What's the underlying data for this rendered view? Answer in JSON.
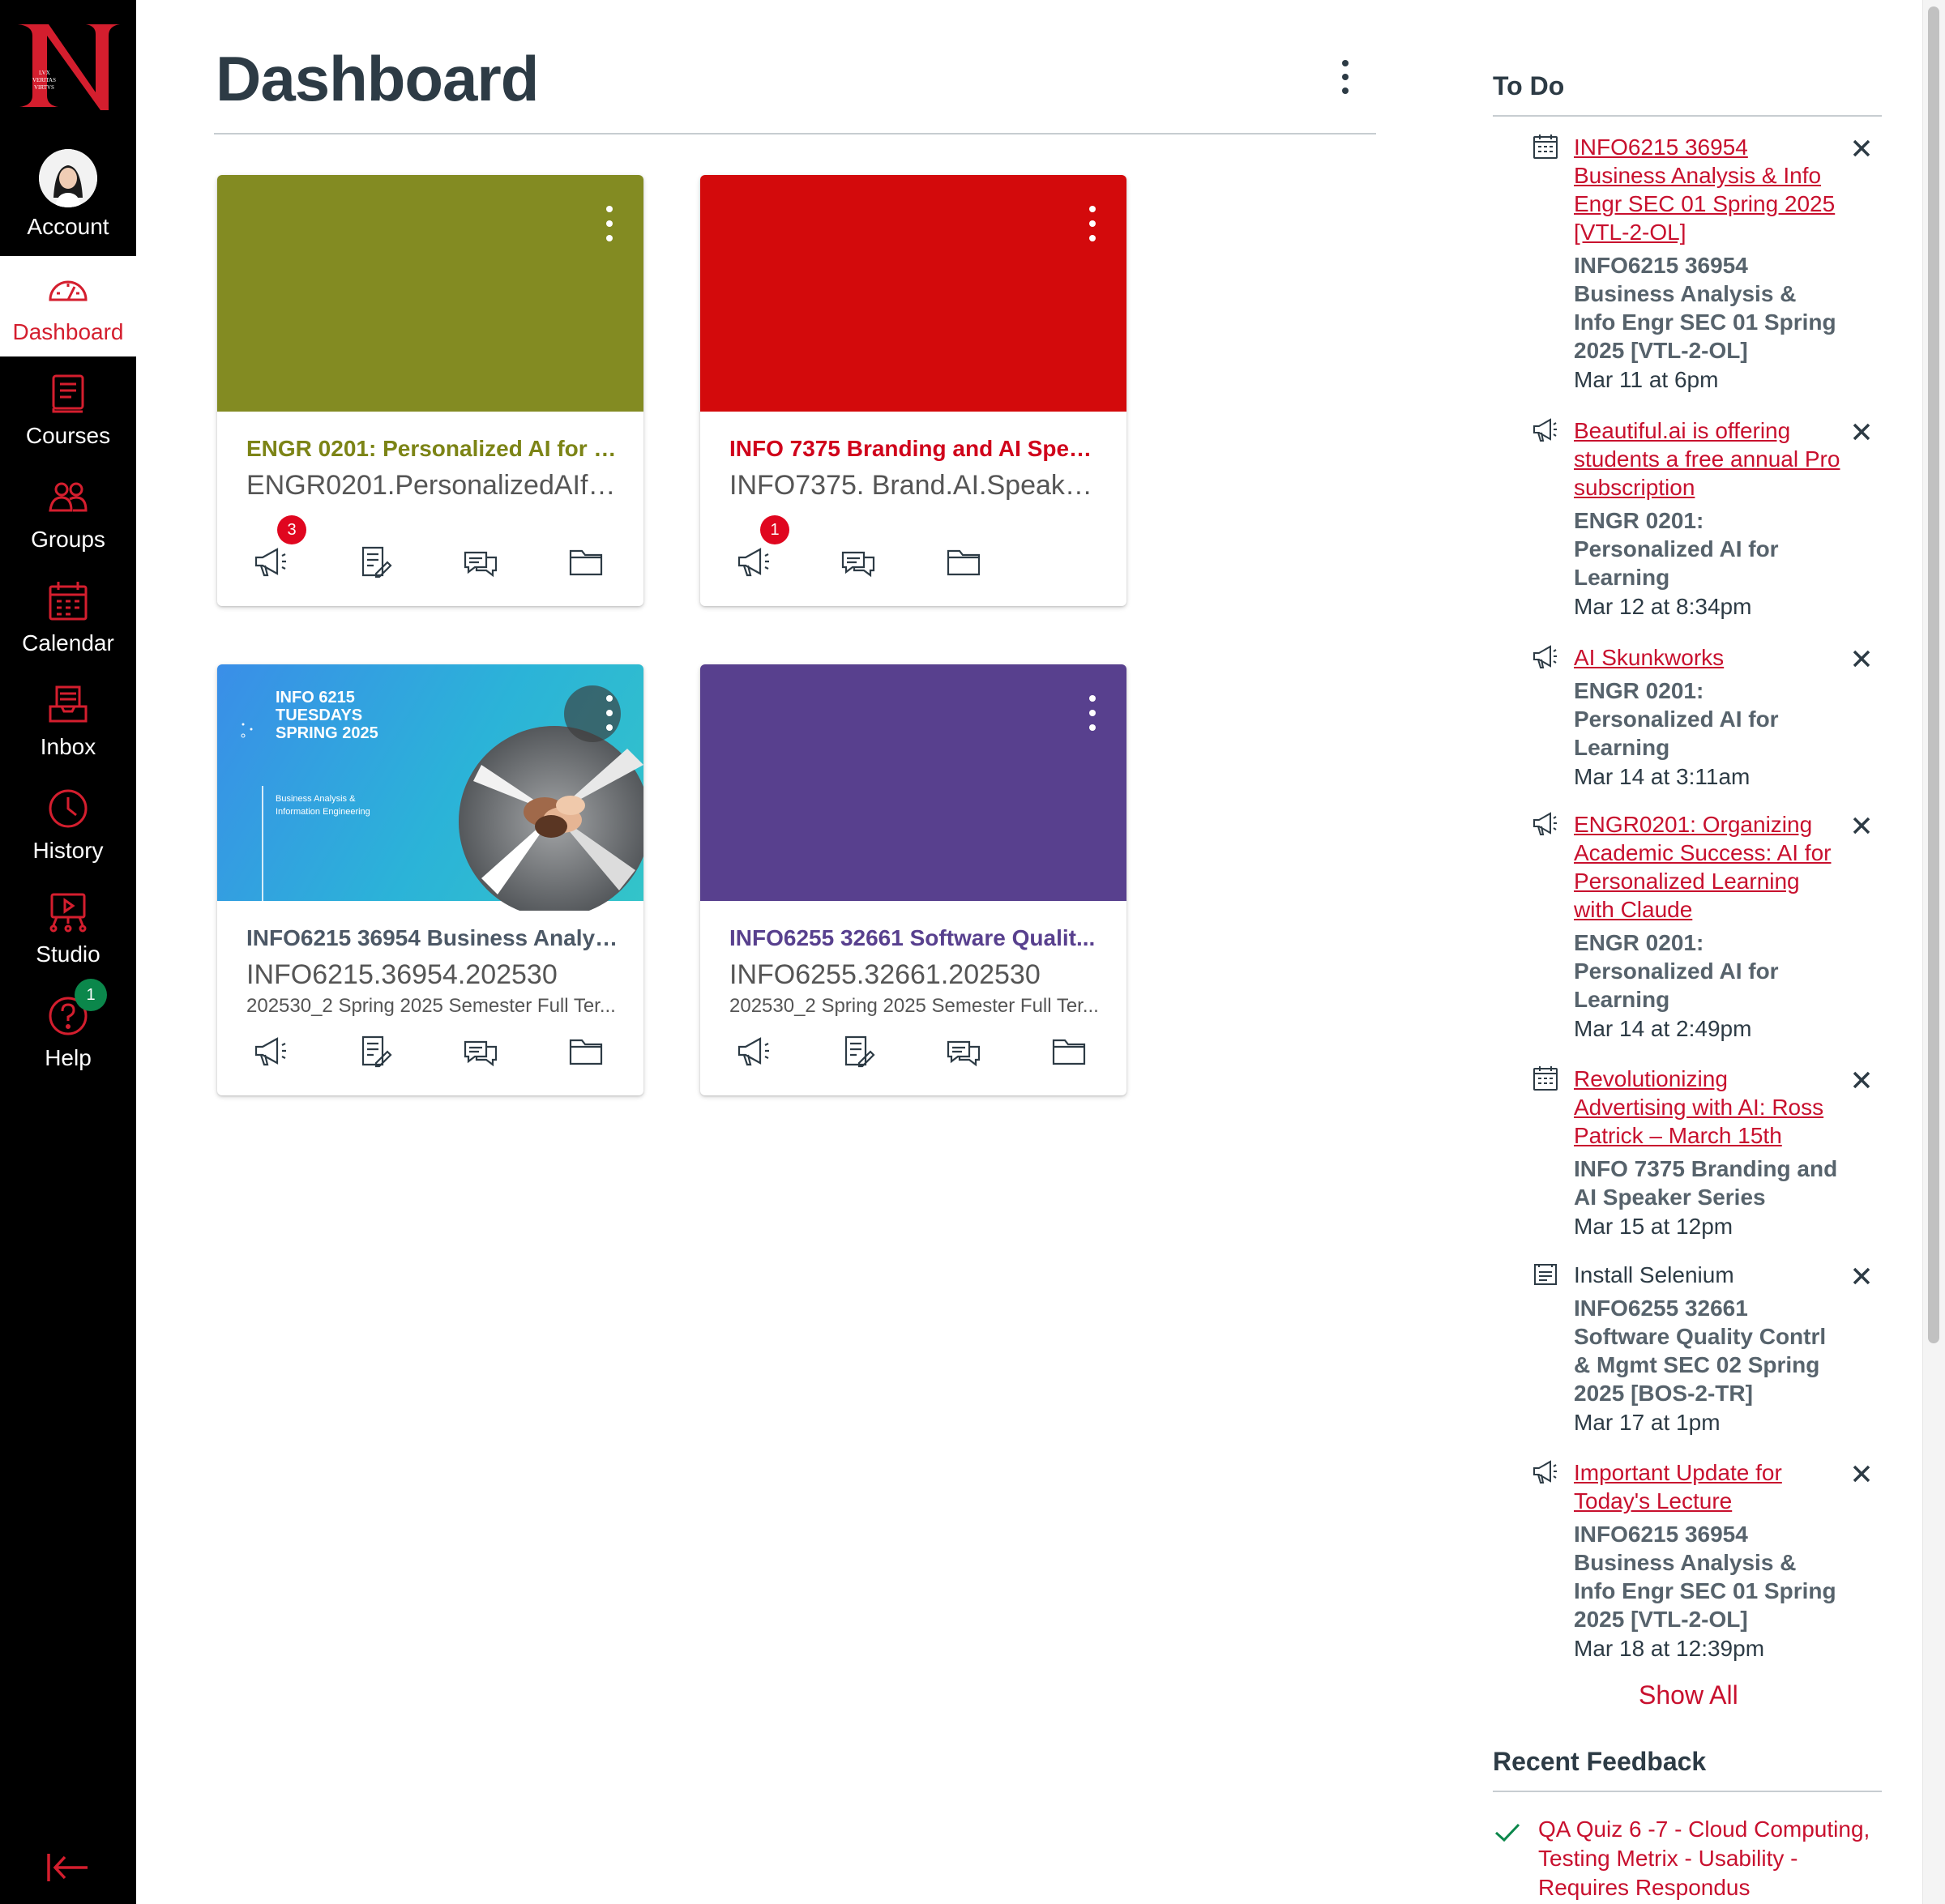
{
  "nav": {
    "account": "Account",
    "dashboard": "Dashboard",
    "courses": "Courses",
    "groups": "Groups",
    "calendar": "Calendar",
    "inbox": "Inbox",
    "history": "History",
    "studio": "Studio",
    "help": "Help",
    "help_badge": "1",
    "logo_words": "LVX VERITAS VIRTVS",
    "accent_color": "#d41e2e"
  },
  "page": {
    "title": "Dashboard"
  },
  "cards": [
    {
      "title": "ENGR 0201: Personalized AI for L...",
      "code": "ENGR0201.PersonalizedAIfor...",
      "term": "",
      "color": "#838b22",
      "announcement_badge": "3"
    },
    {
      "title": "INFO 7375 Branding and AI Speak...",
      "code": "INFO7375. Brand.AI.Speaker....",
      "term": "",
      "color": "#d30a0c",
      "announcement_badge": "1"
    },
    {
      "title": "INFO6215 36954 Business Analys...",
      "code": "INFO6215.36954.202530",
      "term": "202530_2 Spring 2025 Semester Full Ter...",
      "color": "#2bb3d8",
      "hero_line1": "INFO 6215",
      "hero_line2": "TUESDAYS",
      "hero_line3": "SPRING 2025",
      "hero_sub1": "Business Analysis &",
      "hero_sub2": "Information Engineering"
    },
    {
      "title": "INFO6255 32661 Software Qualit...",
      "code": "INFO6255.32661.202530",
      "term": "202530_2 Spring 2025 Semester Full Ter...",
      "color": "#58408e"
    }
  ],
  "todo": {
    "heading": "To Do",
    "items": [
      {
        "icon": "calendar-icon",
        "title": "INFO6215 36954 Business Analysis & Info Engr SEC 01 Spring 2025 [VTL-2-OL]",
        "course": "INFO6215 36954 Business Analysis & Info Engr SEC 01 Spring 2025 [VTL-2-OL]",
        "date": "Mar 11 at 6pm"
      },
      {
        "icon": "announcement-icon",
        "title": "Beautiful.ai is offering students a free annual Pro subscription",
        "course": "ENGR 0201: Personalized AI for Learning",
        "date": "Mar 12 at 8:34pm"
      },
      {
        "icon": "announcement-icon",
        "title": "AI Skunkworks",
        "course": "ENGR 0201: Personalized AI for Learning",
        "date": "Mar 14 at 3:11am"
      },
      {
        "icon": "announcement-icon",
        "title": "ENGR0201: Organizing Academic Success: AI for Personalized Learning with Claude",
        "course": "ENGR 0201: Personalized AI for Learning",
        "date": "Mar 14 at 2:49pm"
      },
      {
        "icon": "calendar-icon",
        "title": "Revolutionizing Advertising with AI: Ross Patrick – March 15th",
        "course": "INFO 7375 Branding and AI Speaker Series",
        "date": "Mar 15 at 12pm"
      },
      {
        "icon": "assignment-icon",
        "title": "Install Selenium",
        "course": "INFO6255 32661 Software Quality Contrl & Mgmt SEC 02 Spring 2025 [BOS-2-TR]",
        "date": "Mar 17 at 1pm"
      },
      {
        "icon": "announcement-icon",
        "title": "Important Update for Today's Lecture",
        "course": "INFO6215 36954 Business Analysis & Info Engr SEC 01 Spring 2025 [VTL-2-OL]",
        "date": "Mar 18 at 12:39pm"
      }
    ],
    "show_all": "Show All"
  },
  "feedback": {
    "heading": "Recent Feedback",
    "items": [
      {
        "title": "QA Quiz 6 -7 - Cloud Computing, Testing Metrix - Usability - Requires Respondus"
      }
    ]
  }
}
